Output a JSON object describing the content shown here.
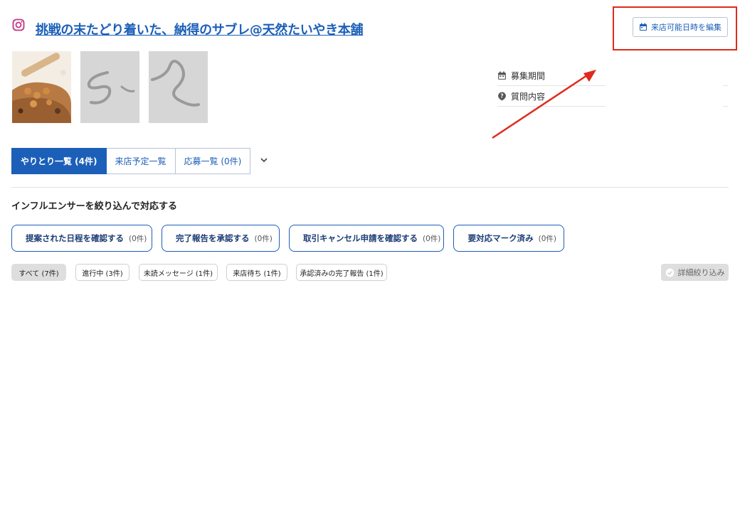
{
  "header": {
    "title": "挑戦の末たどり着いた、納得のサブレ@天然たいやき本舗",
    "platform_icon": "instagram-icon",
    "edit_button_label": "来店可能日時を編集",
    "highlight_color": "#e02a1c"
  },
  "info": {
    "recruit_period_label": "募集期間",
    "question_label": "質問内容"
  },
  "tabs": [
    {
      "label": "やりとり一覧 (4件)",
      "active": true
    },
    {
      "label": "来店予定一覧",
      "active": false
    },
    {
      "label": "応募一覧 (0件)",
      "active": false
    }
  ],
  "filter_section": {
    "title": "インフルエンサーを絞り込んで対応する",
    "actions": [
      {
        "label": "提案された日程を確認する",
        "count": "(0件)",
        "icon": "calendar-icon"
      },
      {
        "label": "完了報告を承認する",
        "count": "(0件)",
        "icon": "report-icon"
      },
      {
        "label": "取引キャンセル申請を確認する",
        "count": "(0件)",
        "icon": "cancel-circle-icon"
      },
      {
        "label": "要対応マーク済み",
        "count": "(0件)",
        "icon": "check-icon"
      }
    ],
    "pills": [
      {
        "label": "すべて (7件)",
        "active": true
      },
      {
        "label": "進行中 (3件)",
        "active": false
      },
      {
        "label": "未読メッセージ (1件)",
        "active": false
      },
      {
        "label": "来店待ち (1件)",
        "active": false
      },
      {
        "label": "承認済みの完了報告 (1件)",
        "active": false
      }
    ],
    "detail_filter_label": "詳細絞り込み"
  },
  "colors": {
    "accent": "#1c5fb8",
    "instagram": "#c13584"
  }
}
